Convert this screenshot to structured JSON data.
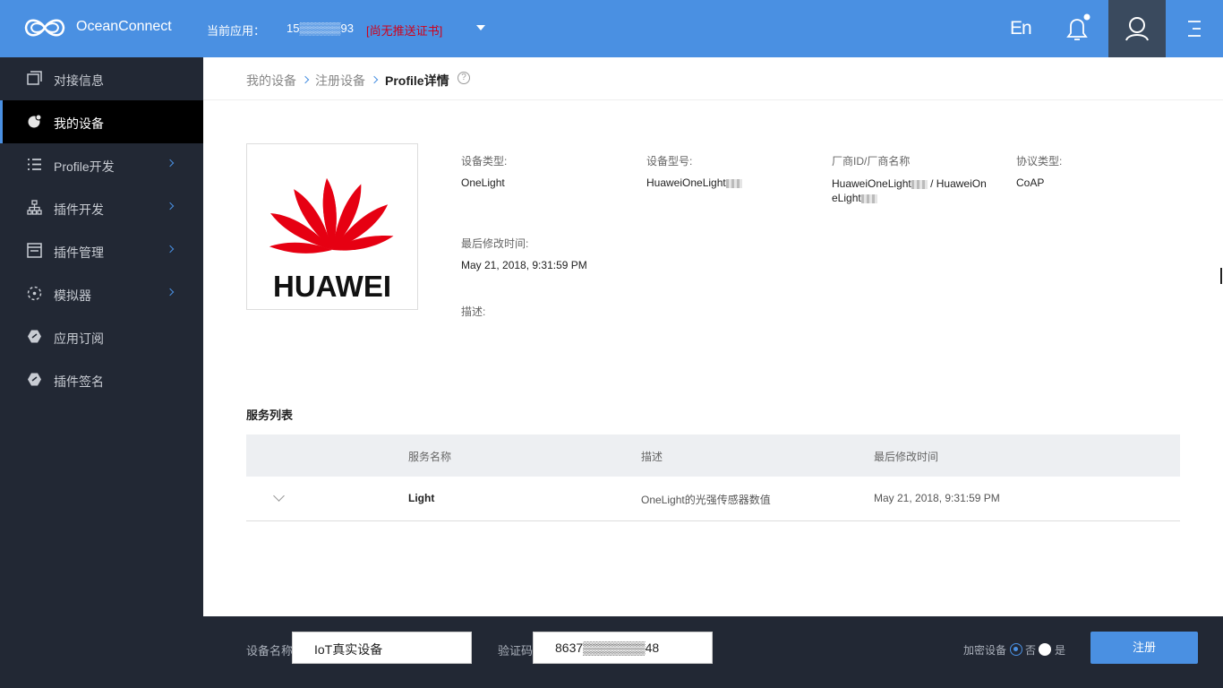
{
  "header": {
    "brand": "OceanConnect",
    "app_label": "当前应用：",
    "app_id": "15▒▒▒▒▒93",
    "cert_status": "[尚无推送证书]",
    "lang_toggle": "En",
    "colors": {
      "bar": "#4a90e2",
      "user_box": "#3a4a5e",
      "cert_warning": "#d0021b"
    },
    "icons": [
      "logo-icon",
      "dropdown-caret-icon",
      "bell-icon",
      "user-icon",
      "menu-icon"
    ]
  },
  "sidebar": {
    "items": [
      {
        "label": "对接信息",
        "icon": "window-icon",
        "has_arrow": false,
        "active": false
      },
      {
        "label": "我的设备",
        "icon": "device-icon",
        "has_arrow": false,
        "active": true
      },
      {
        "label": "Profile开发",
        "icon": "list-icon",
        "has_arrow": true,
        "active": false
      },
      {
        "label": "插件开发",
        "icon": "sitemap-icon",
        "has_arrow": true,
        "active": false
      },
      {
        "label": "插件管理",
        "icon": "panel-icon",
        "has_arrow": true,
        "active": false
      },
      {
        "label": "模拟器",
        "icon": "simulator-icon",
        "has_arrow": true,
        "active": false
      },
      {
        "label": "应用订阅",
        "icon": "hexagon-icon",
        "has_arrow": false,
        "active": false
      },
      {
        "label": "插件签名",
        "icon": "hexagon-icon",
        "has_arrow": false,
        "active": false
      }
    ]
  },
  "breadcrumb": {
    "items": [
      "我的设备",
      "注册设备"
    ],
    "current": "Profile详情",
    "help": "?"
  },
  "device": {
    "logo_text": "HUAWEI",
    "fields": {
      "type_label": "设备类型:",
      "type_value": "OneLight",
      "model_label": "设备型号:",
      "model_value": "HuaweiOneLight",
      "vendor_label": "厂商ID/厂商名称",
      "vendor_value_line1": "HuaweiOneLight",
      "vendor_value_line1b": " / HuaweiOn",
      "vendor_value_line2": "eLight",
      "protocol_label": "协议类型:",
      "protocol_value": "CoAP",
      "modified_label": "最后修改时间:",
      "modified_value": "May 21, 2018, 9:31:59 PM",
      "desc_label": "描述:"
    }
  },
  "services": {
    "title": "服务列表",
    "columns": [
      "服务名称",
      "描述",
      "最后修改时间"
    ],
    "rows": [
      {
        "name": "Light",
        "desc": "OneLight的光强传感器数值",
        "modified": "May 21, 2018, 9:31:59 PM"
      }
    ]
  },
  "register_bar": {
    "name_label": "设备名称",
    "name_value": "IoT真实设备",
    "code_label": "验证码",
    "code_value": "8637▒▒▒▒▒▒▒48",
    "encrypt_label": "加密设备",
    "option_no": "否",
    "option_yes": "是",
    "encrypt_selected": "否",
    "register_button": "注册"
  }
}
